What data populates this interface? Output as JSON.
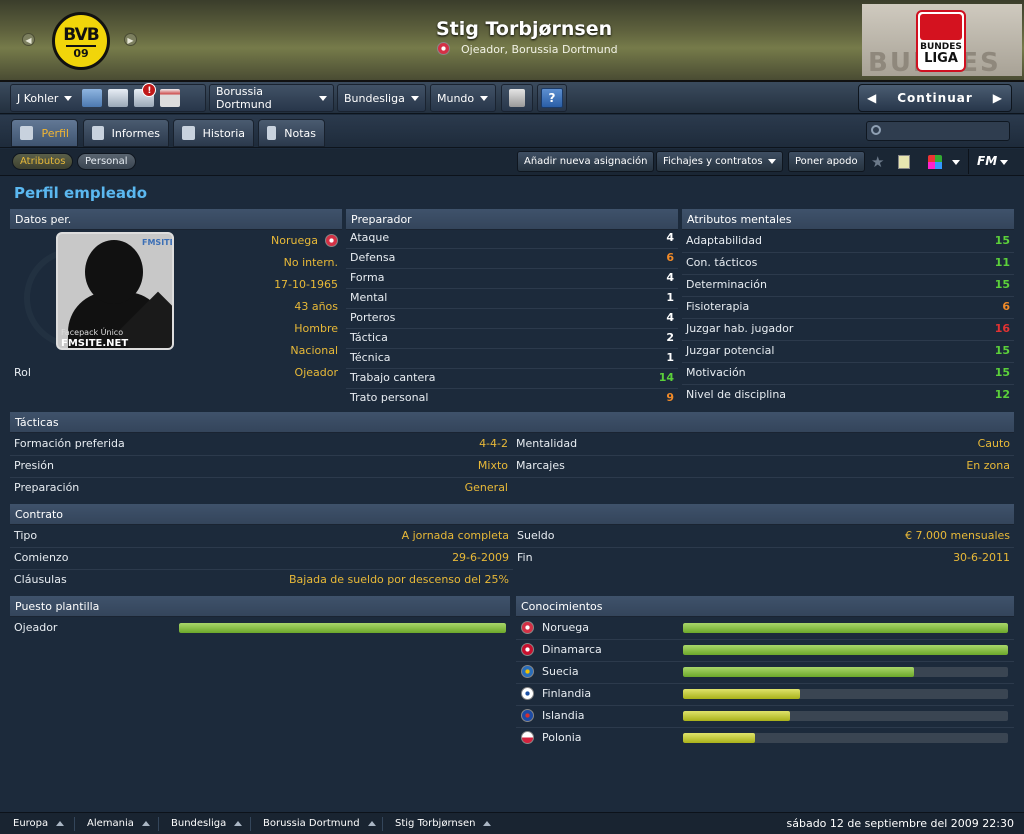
{
  "header": {
    "club_crest": {
      "text1": "BVB",
      "text2": "09"
    },
    "player_name": "Stig Torbjørnsen",
    "player_role": "Ojeador, Borussia Dortmund",
    "league_logo": {
      "line1": "BUNDES",
      "line2": "LIGA",
      "watermark": "BUNDES"
    }
  },
  "toolbar": {
    "manager": "J Kohler",
    "inbox_badge": "!",
    "club": "Borussia Dortmund",
    "competition": "Bundesliga",
    "world": "Mundo",
    "help": "?",
    "continue": "Continuar"
  },
  "tabs": [
    {
      "label": "Perfil"
    },
    {
      "label": "Informes"
    },
    {
      "label": "Historia"
    },
    {
      "label": "Notas"
    }
  ],
  "subtabs": [
    {
      "label": "Atributos"
    },
    {
      "label": "Personal"
    }
  ],
  "actions": {
    "new_assignment": "Añadir nueva asignación",
    "transfers": "Fichajes y contratos",
    "nickname": "Poner apodo",
    "fm": "FM"
  },
  "page_title": "Perfil empleado",
  "personal": {
    "title": "Datos per.",
    "nation": "Noruega",
    "intl": "No intern.",
    "dob": "17-10-1965",
    "age": "43 años",
    "gender": "Hombre",
    "nationality_type": "Nacional",
    "role_label": "Rol",
    "role_value": "Ojeador",
    "photo_caption1": "Facepack Único",
    "photo_caption2": "FMSITE.NET",
    "photo_watermark": "FMSITE"
  },
  "coaching": {
    "title": "Preparador",
    "rows": [
      {
        "label": "Ataque",
        "value": "4",
        "color": "w"
      },
      {
        "label": "Defensa",
        "value": "6",
        "color": "o"
      },
      {
        "label": "Forma",
        "value": "4",
        "color": "w"
      },
      {
        "label": "Mental",
        "value": "1",
        "color": "w"
      },
      {
        "label": "Porteros",
        "value": "4",
        "color": "w"
      },
      {
        "label": "Táctica",
        "value": "2",
        "color": "w"
      },
      {
        "label": "Técnica",
        "value": "1",
        "color": "w"
      },
      {
        "label": "Trabajo cantera",
        "value": "14",
        "color": "g"
      },
      {
        "label": "Trato personal",
        "value": "9",
        "color": "o"
      }
    ]
  },
  "mental": {
    "title": "Atributos mentales",
    "rows": [
      {
        "label": "Adaptabilidad",
        "value": "15",
        "color": "g"
      },
      {
        "label": "Con. tácticos",
        "value": "11",
        "color": "g"
      },
      {
        "label": "Determinación",
        "value": "15",
        "color": "g"
      },
      {
        "label": "Fisioterapia",
        "value": "6",
        "color": "o"
      },
      {
        "label": "Juzgar hab. jugador",
        "value": "16",
        "color": "r"
      },
      {
        "label": "Juzgar potencial",
        "value": "15",
        "color": "g"
      },
      {
        "label": "Motivación",
        "value": "15",
        "color": "g"
      },
      {
        "label": "Nivel de disciplina",
        "value": "12",
        "color": "g"
      }
    ]
  },
  "tactics": {
    "title": "Tácticas",
    "formation_label": "Formación preferida",
    "formation": "4-4-2",
    "pressing_label": "Presión",
    "pressing": "Mixto",
    "training_label": "Preparación",
    "training": "General",
    "mentality_label": "Mentalidad",
    "mentality": "Cauto",
    "marking_label": "Marcajes",
    "marking": "En zona"
  },
  "contract": {
    "title": "Contrato",
    "type_label": "Tipo",
    "type": "A jornada completa",
    "start_label": "Comienzo",
    "start": "29-6-2009",
    "clauses_label": "Cláusulas",
    "clauses": "Bajada de sueldo por descenso del 25%",
    "wage_label": "Sueldo",
    "wage": "€ 7.000 mensuales",
    "end_label": "Fin",
    "end": "30-6-2011"
  },
  "squad_position": {
    "title": "Puesto plantilla",
    "label": "Ojeador",
    "level": 1.0
  },
  "knowledge": {
    "title": "Conocimientos",
    "rows": [
      {
        "label": "Noruega",
        "flag": "no",
        "level": 1.0,
        "tone": "green"
      },
      {
        "label": "Dinamarca",
        "flag": "dk",
        "level": 1.0,
        "tone": "green"
      },
      {
        "label": "Suecia",
        "flag": "se",
        "level": 0.71,
        "tone": "green"
      },
      {
        "label": "Finlandia",
        "flag": "fi",
        "level": 0.36,
        "tone": "yellow"
      },
      {
        "label": "Islandia",
        "flag": "is",
        "level": 0.33,
        "tone": "yellow"
      },
      {
        "label": "Polonia",
        "flag": "pl",
        "level": 0.22,
        "tone": "yellow"
      }
    ]
  },
  "status_bar": {
    "crumbs": [
      "Europa",
      "Alemania",
      "Bundesliga",
      "Borussia Dortmund",
      "Stig Torbjørnsen"
    ],
    "datetime": "sábado 12 de septiembre del 2009 22:30"
  }
}
